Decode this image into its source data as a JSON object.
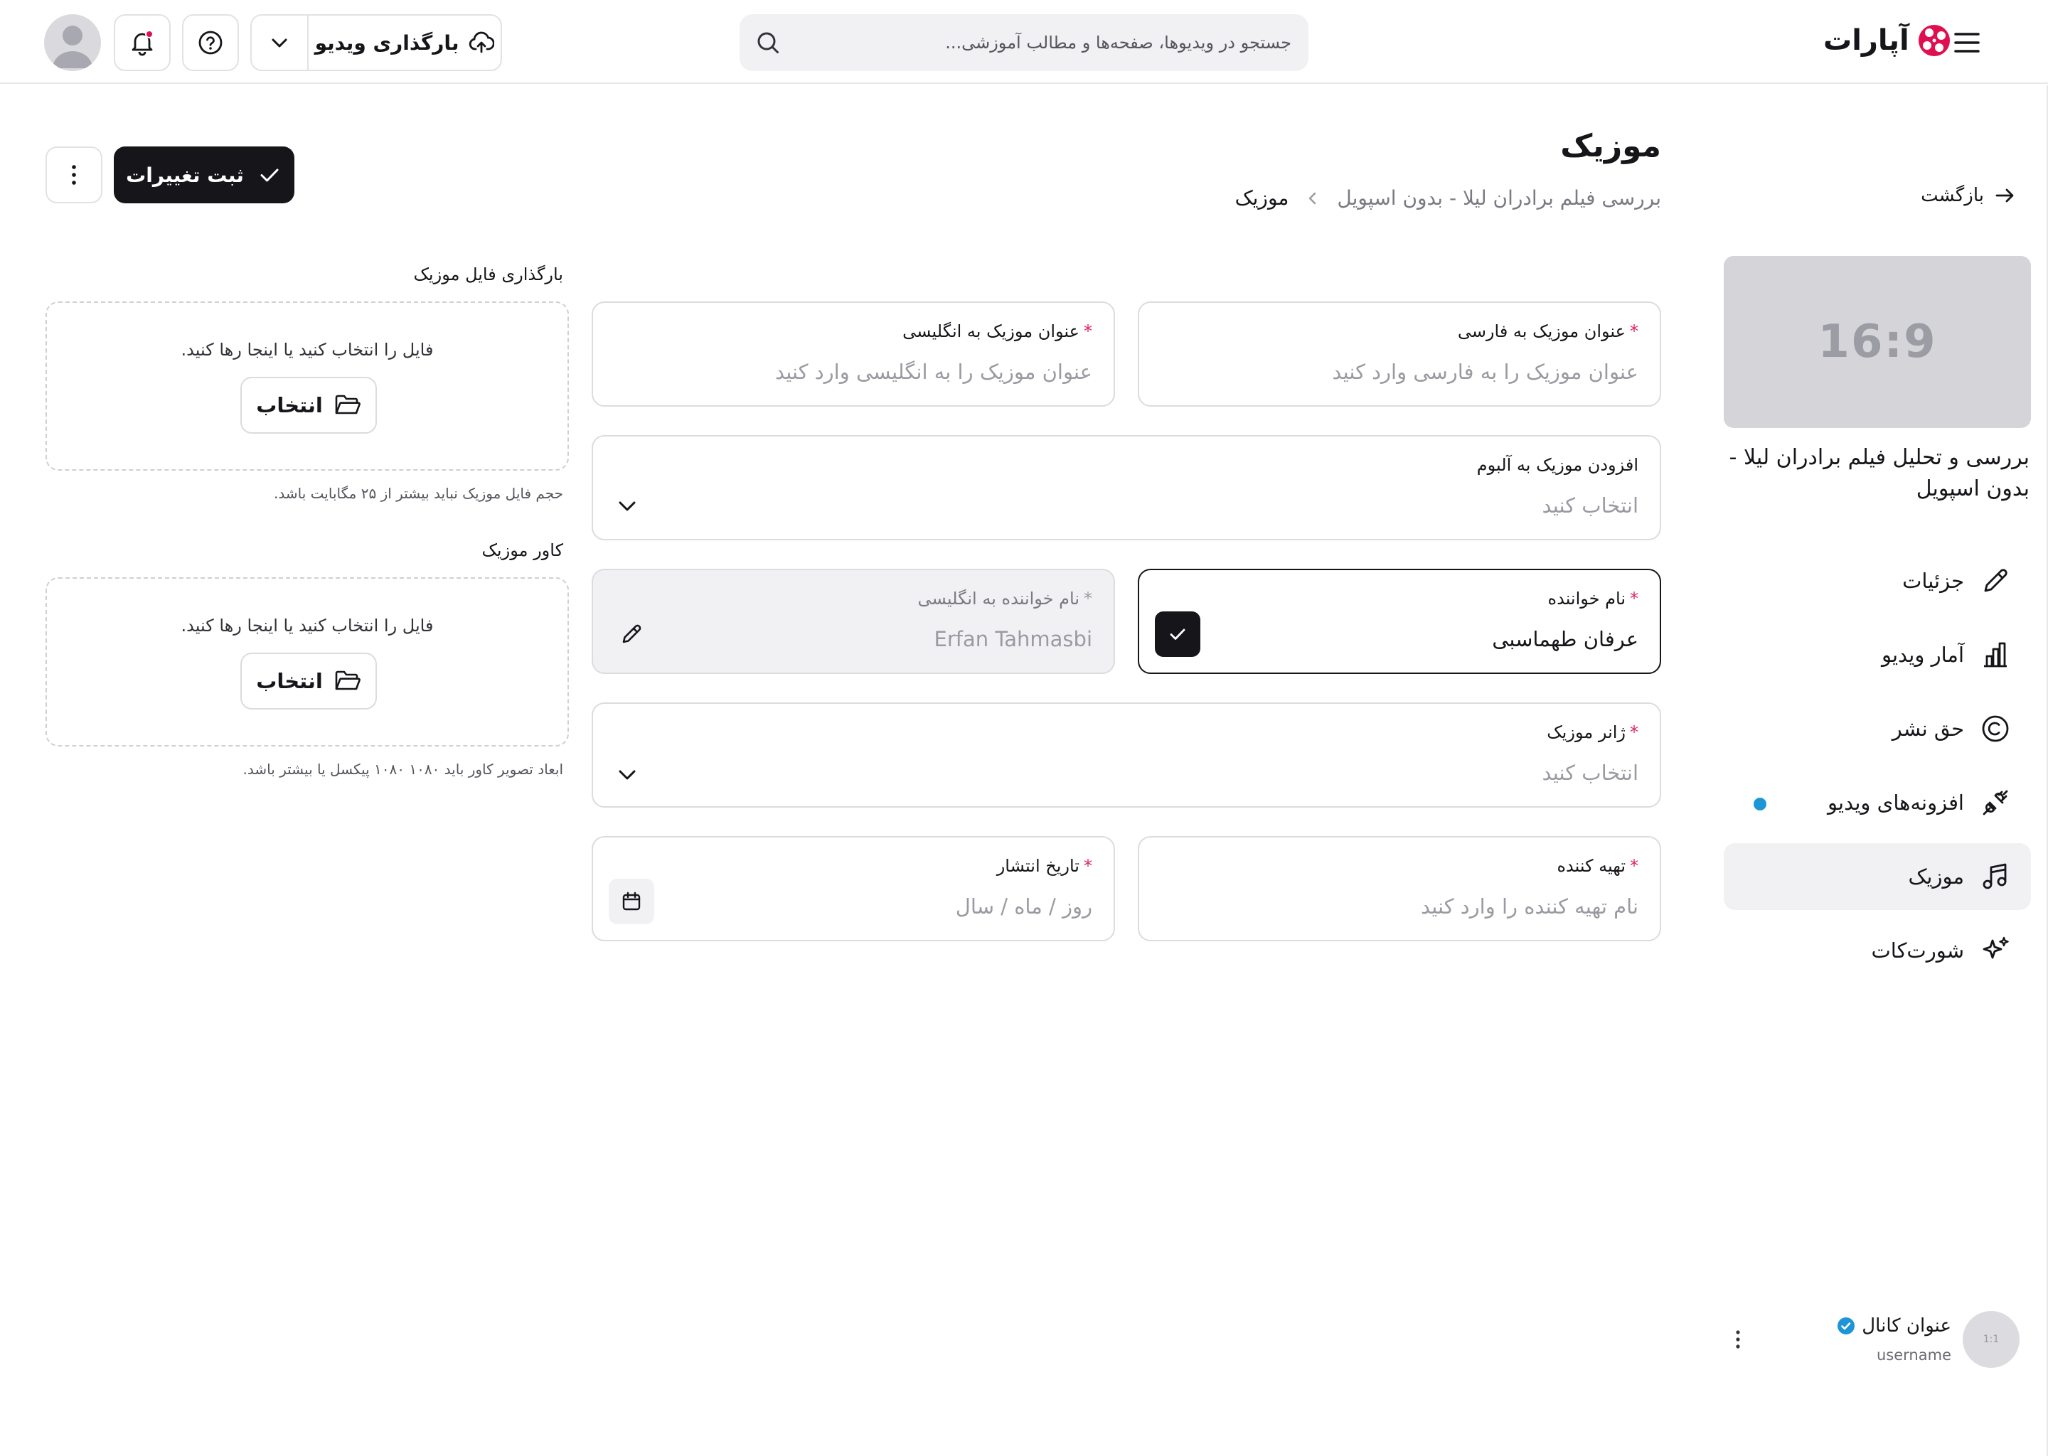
{
  "header": {
    "logo_text": "آپارات",
    "search_placeholder": "جستجو در ویدیوها، صفحه‌ها و مطالب آموزشی...",
    "upload_label": "بارگذاری ویدیو"
  },
  "sidebar": {
    "back_label": "بازگشت",
    "thumbnail_ratio": "16:9",
    "video_title": "بررسی و تحلیل فیلم برادران لیلا - بدون اسپویل",
    "items": [
      {
        "label": "جزئیات",
        "icon": "pencil-icon"
      },
      {
        "label": "آمار ویدیو",
        "icon": "chart-icon"
      },
      {
        "label": "حق نشر",
        "icon": "copyright-icon"
      },
      {
        "label": "افزونه‌های ویدیو",
        "icon": "plug-icon"
      },
      {
        "label": "موزیک",
        "icon": "music-icon"
      },
      {
        "label": "شورت‌کات",
        "icon": "sparkle-icon"
      }
    ],
    "channel": {
      "avatar_ratio": "1:1",
      "name": "عنوان کانال",
      "username": "username"
    }
  },
  "main": {
    "title": "موزیک",
    "breadcrumb": {
      "parent": "بررسی فیلم برادران لیلا - بدون اسپویل",
      "current": "موزیک"
    },
    "save_label": "ثبت تغییرات",
    "fields": {
      "title_fa": {
        "label": "عنوان موزیک به فارسی",
        "placeholder": "عنوان موزیک را به فارسی وارد کنید"
      },
      "title_en": {
        "label": "عنوان موزیک به انگلیسی",
        "placeholder": "عنوان موزیک را به انگلیسی وارد کنید"
      },
      "album": {
        "label": "افزودن موزیک به آلبوم",
        "placeholder": "انتخاب کنید"
      },
      "singer": {
        "label": "نام خواننده",
        "value": "عرفان طهماسبی"
      },
      "singer_en": {
        "label": "نام خواننده به انگلیسی",
        "value": "Erfan Tahmasbi"
      },
      "genre": {
        "label": "ژانر موزیک",
        "placeholder": "انتخاب کنید"
      },
      "producer": {
        "label": "تهیه کننده",
        "placeholder": "نام تهیه کننده را وارد کنید"
      },
      "release_date": {
        "label": "تاریخ انتشار",
        "placeholder": "روز / ماه / سال"
      }
    },
    "upload_music": {
      "label": "بارگذاری فایل موزیک",
      "drop_text": "فایل را انتخاب کنید یا اینجا رها کنید.",
      "button": "انتخاب",
      "hint": "حجم فایل موزیک نباید بیشتر از ۲۵ مگابایت باشد."
    },
    "upload_cover": {
      "label": "کاور موزیک",
      "drop_text": "فایل را انتخاب کنید یا اینجا رها کنید.",
      "button": "انتخاب",
      "hint": "ابعاد تصویر کاور باید ۱۰۸۰ ۱۰۸۰ پیکسل یا بیشتر باشد."
    }
  },
  "colors": {
    "accent": "#16161a",
    "required": "#e0245e",
    "brand": "#df0f50",
    "badge": "#1e96d6"
  }
}
